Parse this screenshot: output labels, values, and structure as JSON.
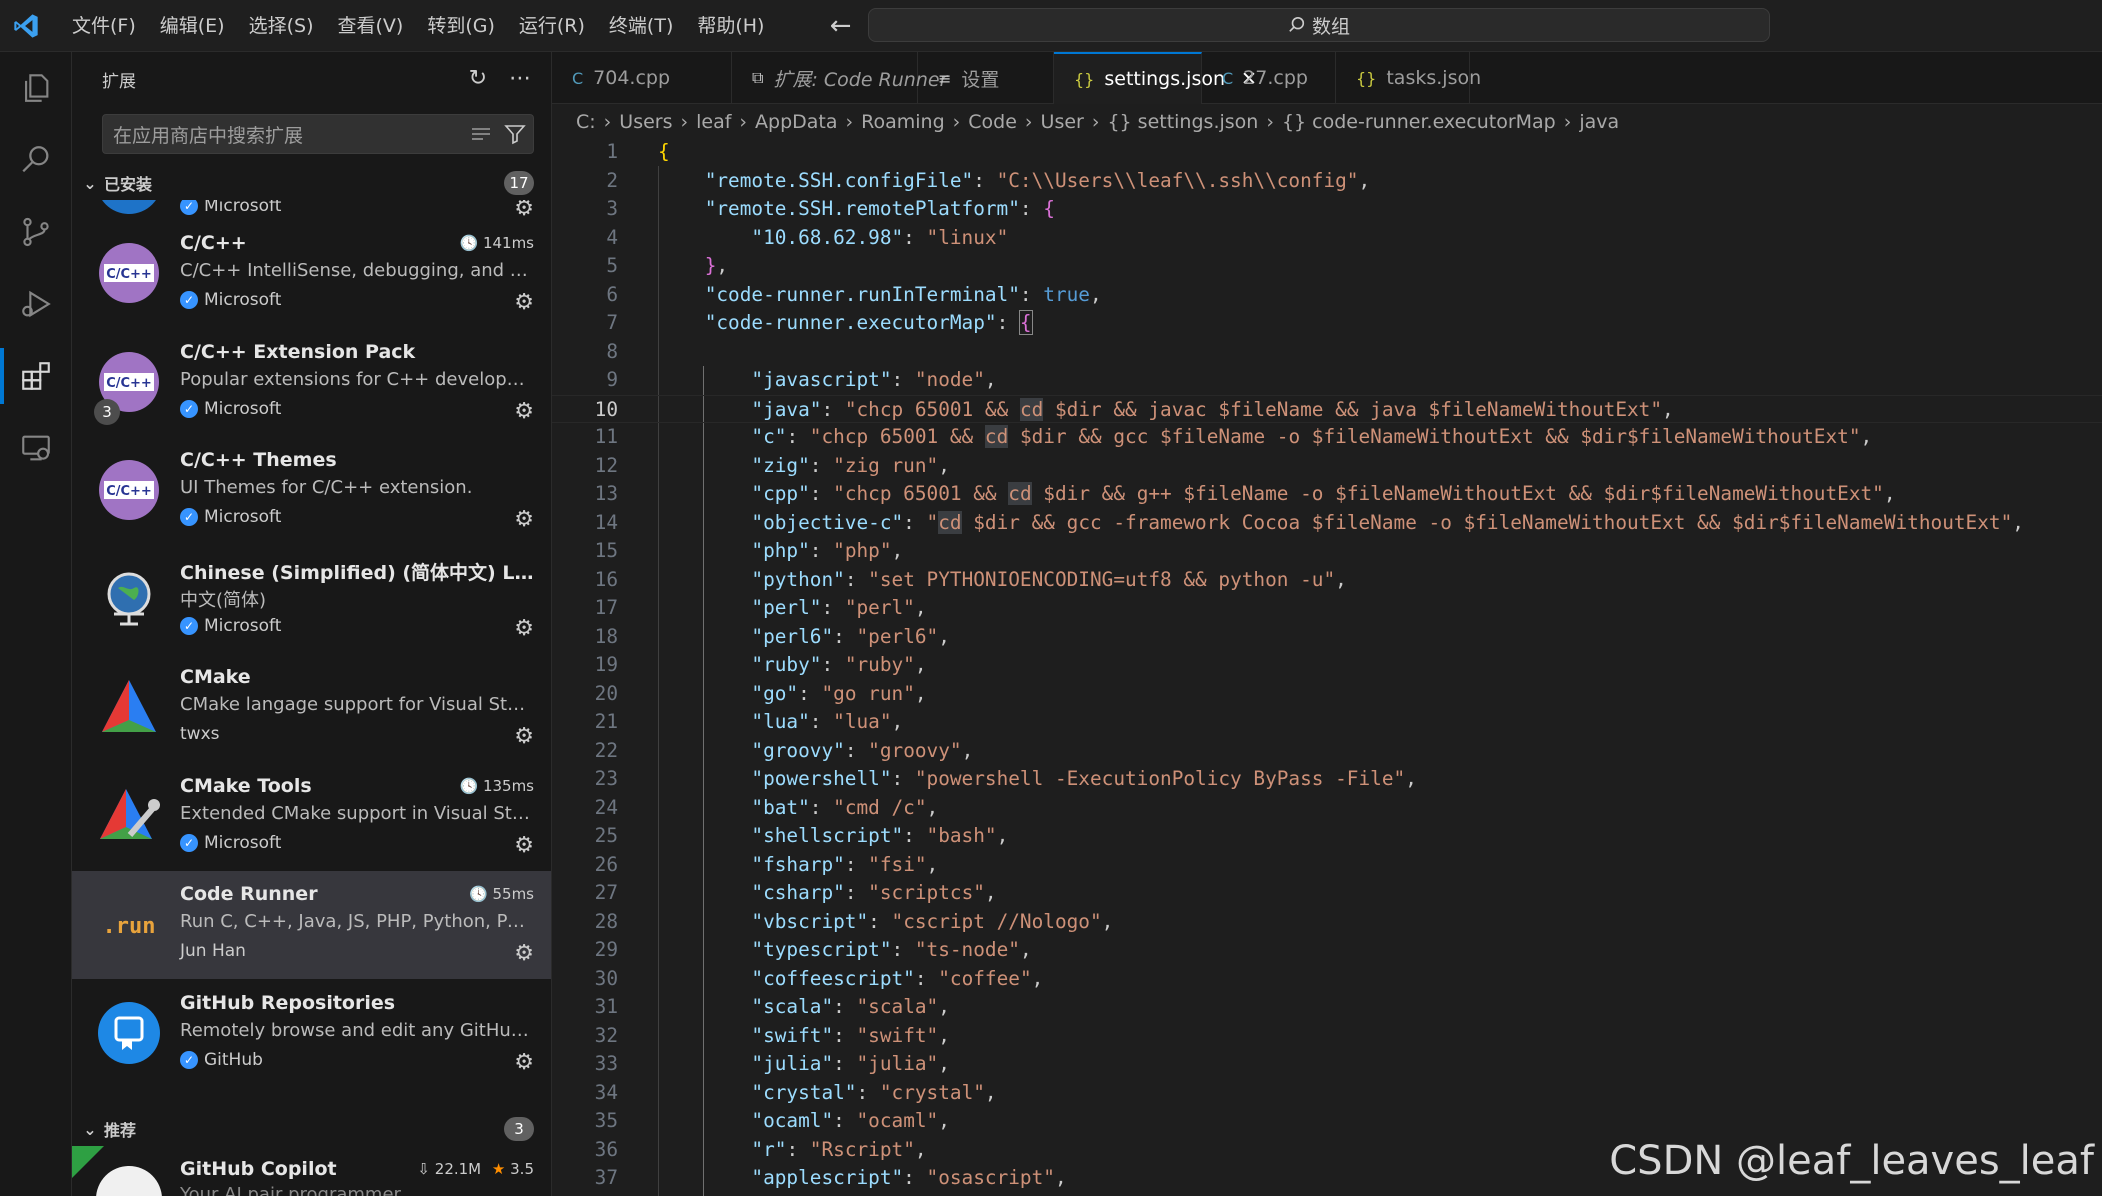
{
  "titlebar": {
    "menu": [
      "文件(F)",
      "编辑(E)",
      "选择(S)",
      "查看(V)",
      "转到(G)",
      "运行(R)",
      "终端(T)",
      "帮助(H)"
    ],
    "search_text": "数组"
  },
  "sidebar": {
    "title": "扩展",
    "search_placeholder": "在应用商店中搜索扩展",
    "installed_label": "已安装",
    "installed_count": "17",
    "recommended_label": "推荐",
    "recommended_count": "3",
    "partial_top_publisher": "Microsoft",
    "extensions": [
      {
        "name": "C/C++",
        "desc": "C/C++ IntelliSense, debugging, and co...",
        "publisher": "Microsoft",
        "verified": true,
        "time": "141ms",
        "icon": "cpp-icon"
      },
      {
        "name": "C/C++ Extension Pack",
        "desc": "Popular extensions for C++ developme...",
        "publisher": "Microsoft",
        "verified": true,
        "time": "",
        "badge": "3",
        "icon": "cpp-icon"
      },
      {
        "name": "C/C++ Themes",
        "desc": "UI Themes for C/C++ extension.",
        "publisher": "Microsoft",
        "verified": true,
        "time": "",
        "icon": "cpp-icon"
      },
      {
        "name": "Chinese (Simplified) (简体中文) Lang...",
        "desc": "中文(简体)",
        "publisher": "Microsoft",
        "verified": true,
        "time": "",
        "icon": "globe-icon"
      },
      {
        "name": "CMake",
        "desc": "CMake langage support for Visual Studi...",
        "publisher": "twxs",
        "verified": false,
        "time": "",
        "icon": "cmake-icon"
      },
      {
        "name": "CMake Tools",
        "desc": "Extended CMake support in Visual Stud...",
        "publisher": "Microsoft",
        "verified": true,
        "time": "135ms",
        "icon": "cmake-tools-icon"
      },
      {
        "name": "Code Runner",
        "desc": "Run C, C++, Java, JS, PHP, Python, Perl, ...",
        "publisher": "Jun Han",
        "verified": false,
        "time": "55ms",
        "icon": "run-icon",
        "selected": true
      },
      {
        "name": "GitHub Repositories",
        "desc": "Remotely browse and edit any GitHub r...",
        "publisher": "GitHub",
        "verified": true,
        "time": "",
        "icon": "github-repo-icon"
      }
    ],
    "recommended": {
      "name": "GitHub Copilot",
      "downloads": "22.1M",
      "rating": "3.5",
      "partial_desc": "Your AI pair programmer"
    }
  },
  "tabs": [
    {
      "label": "704.cpp",
      "icon": "C",
      "icon_color": "#519aba",
      "active": false,
      "italic": false
    },
    {
      "label": "扩展: Code Runner",
      "icon": "⧉",
      "icon_color": "#cccccc",
      "active": false,
      "italic": true
    },
    {
      "label": "设置",
      "icon": "≡",
      "icon_color": "#cccccc",
      "active": false,
      "italic": false
    },
    {
      "label": "settings.json",
      "icon": "{}",
      "icon_color": "#cbcb41",
      "active": true,
      "italic": false
    },
    {
      "label": "27.cpp",
      "icon": "C",
      "icon_color": "#519aba",
      "active": false,
      "italic": false
    },
    {
      "label": "tasks.json",
      "icon": "{}",
      "icon_color": "#cbcb41",
      "active": false,
      "italic": false
    }
  ],
  "breadcrumb": [
    "C:",
    "Users",
    "leaf",
    "AppData",
    "Roaming",
    "Code",
    "User",
    "{} settings.json",
    "{} code-runner.executorMap",
    "java"
  ],
  "code": {
    "current_line": 10,
    "lines": [
      [
        [
          "b1",
          "{"
        ]
      ],
      [
        [
          "p",
          "    "
        ],
        [
          "k",
          "\"remote.SSH.configFile\""
        ],
        [
          "p",
          ": "
        ],
        [
          "s",
          "\"C:\\\\Users\\\\leaf\\\\.ssh\\\\config\""
        ],
        [
          "p",
          ","
        ]
      ],
      [
        [
          "p",
          "    "
        ],
        [
          "k",
          "\"remote.SSH.remotePlatform\""
        ],
        [
          "p",
          ": "
        ],
        [
          "b2",
          "{"
        ]
      ],
      [
        [
          "p",
          "        "
        ],
        [
          "k",
          "\"10.68.62.98\""
        ],
        [
          "p",
          ": "
        ],
        [
          "s",
          "\"linux\""
        ]
      ],
      [
        [
          "p",
          "    "
        ],
        [
          "b2",
          "}"
        ],
        [
          "p",
          ","
        ]
      ],
      [
        [
          "p",
          "    "
        ],
        [
          "k",
          "\"code-runner.runInTerminal\""
        ],
        [
          "p",
          ": "
        ],
        [
          "kw",
          "true"
        ],
        [
          "p",
          ","
        ]
      ],
      [
        [
          "p",
          "    "
        ],
        [
          "k",
          "\"code-runner.executorMap\""
        ],
        [
          "p",
          ": "
        ],
        [
          "b2box",
          "{"
        ]
      ],
      [
        [
          "p",
          ""
        ]
      ],
      [
        [
          "p",
          "        "
        ],
        [
          "k",
          "\"javascript\""
        ],
        [
          "p",
          ": "
        ],
        [
          "s",
          "\"node\""
        ],
        [
          "p",
          ","
        ]
      ],
      [
        [
          "p",
          "        "
        ],
        [
          "k",
          "\"java\""
        ],
        [
          "p",
          ": "
        ],
        [
          "s",
          "\"chcp 65001 && "
        ],
        [
          "shl",
          "cd"
        ],
        [
          "s",
          " $dir && javac $fileName && java $fileNameWithoutExt\""
        ],
        [
          "p",
          ","
        ]
      ],
      [
        [
          "p",
          "        "
        ],
        [
          "k",
          "\"c\""
        ],
        [
          "p",
          ": "
        ],
        [
          "s",
          "\"chcp 65001 && "
        ],
        [
          "shl",
          "cd"
        ],
        [
          "s",
          " $dir && gcc $fileName -o $fileNameWithoutExt && $dir$fileNameWithoutExt\""
        ],
        [
          "p",
          ","
        ]
      ],
      [
        [
          "p",
          "        "
        ],
        [
          "k",
          "\"zig\""
        ],
        [
          "p",
          ": "
        ],
        [
          "s",
          "\"zig run\""
        ],
        [
          "p",
          ","
        ]
      ],
      [
        [
          "p",
          "        "
        ],
        [
          "k",
          "\"cpp\""
        ],
        [
          "p",
          ": "
        ],
        [
          "s",
          "\"chcp 65001 && "
        ],
        [
          "shl",
          "cd"
        ],
        [
          "s",
          " $dir && g++ $fileName -o $fileNameWithoutExt && $dir$fileNameWithoutExt\""
        ],
        [
          "p",
          ","
        ]
      ],
      [
        [
          "p",
          "        "
        ],
        [
          "k",
          "\"objective-c\""
        ],
        [
          "p",
          ": "
        ],
        [
          "s",
          "\""
        ],
        [
          "shl",
          "cd"
        ],
        [
          "s",
          " $dir && gcc -framework Cocoa $fileName -o $fileNameWithoutExt && $dir$fileNameWithoutExt\""
        ],
        [
          "p",
          ","
        ]
      ],
      [
        [
          "p",
          "        "
        ],
        [
          "k",
          "\"php\""
        ],
        [
          "p",
          ": "
        ],
        [
          "s",
          "\"php\""
        ],
        [
          "p",
          ","
        ]
      ],
      [
        [
          "p",
          "        "
        ],
        [
          "k",
          "\"python\""
        ],
        [
          "p",
          ": "
        ],
        [
          "s",
          "\"set PYTHONIOENCODING=utf8 && python -u\""
        ],
        [
          "p",
          ","
        ]
      ],
      [
        [
          "p",
          "        "
        ],
        [
          "k",
          "\"perl\""
        ],
        [
          "p",
          ": "
        ],
        [
          "s",
          "\"perl\""
        ],
        [
          "p",
          ","
        ]
      ],
      [
        [
          "p",
          "        "
        ],
        [
          "k",
          "\"perl6\""
        ],
        [
          "p",
          ": "
        ],
        [
          "s",
          "\"perl6\""
        ],
        [
          "p",
          ","
        ]
      ],
      [
        [
          "p",
          "        "
        ],
        [
          "k",
          "\"ruby\""
        ],
        [
          "p",
          ": "
        ],
        [
          "s",
          "\"ruby\""
        ],
        [
          "p",
          ","
        ]
      ],
      [
        [
          "p",
          "        "
        ],
        [
          "k",
          "\"go\""
        ],
        [
          "p",
          ": "
        ],
        [
          "s",
          "\"go run\""
        ],
        [
          "p",
          ","
        ]
      ],
      [
        [
          "p",
          "        "
        ],
        [
          "k",
          "\"lua\""
        ],
        [
          "p",
          ": "
        ],
        [
          "s",
          "\"lua\""
        ],
        [
          "p",
          ","
        ]
      ],
      [
        [
          "p",
          "        "
        ],
        [
          "k",
          "\"groovy\""
        ],
        [
          "p",
          ": "
        ],
        [
          "s",
          "\"groovy\""
        ],
        [
          "p",
          ","
        ]
      ],
      [
        [
          "p",
          "        "
        ],
        [
          "k",
          "\"powershell\""
        ],
        [
          "p",
          ": "
        ],
        [
          "s",
          "\"powershell -ExecutionPolicy ByPass -File\""
        ],
        [
          "p",
          ","
        ]
      ],
      [
        [
          "p",
          "        "
        ],
        [
          "k",
          "\"bat\""
        ],
        [
          "p",
          ": "
        ],
        [
          "s",
          "\"cmd /c\""
        ],
        [
          "p",
          ","
        ]
      ],
      [
        [
          "p",
          "        "
        ],
        [
          "k",
          "\"shellscript\""
        ],
        [
          "p",
          ": "
        ],
        [
          "s",
          "\"bash\""
        ],
        [
          "p",
          ","
        ]
      ],
      [
        [
          "p",
          "        "
        ],
        [
          "k",
          "\"fsharp\""
        ],
        [
          "p",
          ": "
        ],
        [
          "s",
          "\"fsi\""
        ],
        [
          "p",
          ","
        ]
      ],
      [
        [
          "p",
          "        "
        ],
        [
          "k",
          "\"csharp\""
        ],
        [
          "p",
          ": "
        ],
        [
          "s",
          "\"scriptcs\""
        ],
        [
          "p",
          ","
        ]
      ],
      [
        [
          "p",
          "        "
        ],
        [
          "k",
          "\"vbscript\""
        ],
        [
          "p",
          ": "
        ],
        [
          "s",
          "\"cscript //Nologo\""
        ],
        [
          "p",
          ","
        ]
      ],
      [
        [
          "p",
          "        "
        ],
        [
          "k",
          "\"typescript\""
        ],
        [
          "p",
          ": "
        ],
        [
          "s",
          "\"ts-node\""
        ],
        [
          "p",
          ","
        ]
      ],
      [
        [
          "p",
          "        "
        ],
        [
          "k",
          "\"coffeescript\""
        ],
        [
          "p",
          ": "
        ],
        [
          "s",
          "\"coffee\""
        ],
        [
          "p",
          ","
        ]
      ],
      [
        [
          "p",
          "        "
        ],
        [
          "k",
          "\"scala\""
        ],
        [
          "p",
          ": "
        ],
        [
          "s",
          "\"scala\""
        ],
        [
          "p",
          ","
        ]
      ],
      [
        [
          "p",
          "        "
        ],
        [
          "k",
          "\"swift\""
        ],
        [
          "p",
          ": "
        ],
        [
          "s",
          "\"swift\""
        ],
        [
          "p",
          ","
        ]
      ],
      [
        [
          "p",
          "        "
        ],
        [
          "k",
          "\"julia\""
        ],
        [
          "p",
          ": "
        ],
        [
          "s",
          "\"julia\""
        ],
        [
          "p",
          ","
        ]
      ],
      [
        [
          "p",
          "        "
        ],
        [
          "k",
          "\"crystal\""
        ],
        [
          "p",
          ": "
        ],
        [
          "s",
          "\"crystal\""
        ],
        [
          "p",
          ","
        ]
      ],
      [
        [
          "p",
          "        "
        ],
        [
          "k",
          "\"ocaml\""
        ],
        [
          "p",
          ": "
        ],
        [
          "s",
          "\"ocaml\""
        ],
        [
          "p",
          ","
        ]
      ],
      [
        [
          "p",
          "        "
        ],
        [
          "k",
          "\"r\""
        ],
        [
          "p",
          ": "
        ],
        [
          "s",
          "\"Rscript\""
        ],
        [
          "p",
          ","
        ]
      ],
      [
        [
          "p",
          "        "
        ],
        [
          "k",
          "\"applescript\""
        ],
        [
          "p",
          ": "
        ],
        [
          "s",
          "\"osascript\""
        ],
        [
          "p",
          ","
        ]
      ]
    ]
  },
  "watermark": "CSDN @leaf_leaves_leaf",
  "colors": {
    "accent": "#0078d4",
    "key": "#9cdcfe",
    "string": "#ce9178",
    "bracket1": "#ffd700",
    "bracket2": "#da70d6",
    "keyword": "#569cd6"
  }
}
